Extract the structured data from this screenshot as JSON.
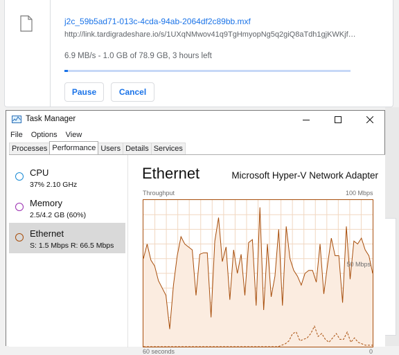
{
  "download": {
    "filename": "j2c_59b5ad71-013c-4cda-94ab-2064df2c89bb.mxf",
    "url": "http://link.tardigradeshare.io/s/1UXqNMwov41q9TgHmyopNg5q2giQ8aTdh1gjKWKjf…",
    "status": "6.9 MB/s - 1.0 GB of 78.9 GB, 3 hours left",
    "progress": 0.0127,
    "pause_label": "Pause",
    "cancel_label": "Cancel"
  },
  "task_manager": {
    "title": "Task Manager",
    "menu": [
      "File",
      "Options",
      "View"
    ],
    "tabs": [
      "Processes",
      "Performance",
      "Users",
      "Details",
      "Services"
    ],
    "active_tab": "Performance",
    "resources": [
      {
        "name": "CPU",
        "sub": "37%  2.10 GHz",
        "color": "#1a8ad4",
        "selected": false
      },
      {
        "name": "Memory",
        "sub": "2.5/4.2 GB (60%)",
        "color": "#9a2db1",
        "selected": false
      },
      {
        "name": "Ethernet",
        "sub": "S: 1.5 Mbps  R: 66.5 Mbps",
        "color": "#a74d0a",
        "selected": true
      }
    ],
    "detail": {
      "title": "Ethernet",
      "adapter": "Microsoft Hyper-V Network Adapter",
      "graph_label": "Throughput",
      "max_label": "100 Mbps",
      "mid_label": "50 Mbps",
      "time_label": "60 seconds",
      "min_label": "0"
    },
    "colors": {
      "line": "#a74d0a",
      "fill": "#fbece0",
      "grid": "#f1d7c1"
    },
    "receive_mbps": [
      60,
      70,
      59,
      55,
      45,
      40,
      35,
      12,
      42,
      62,
      75,
      70,
      68,
      66,
      35,
      63,
      64,
      64,
      20,
      72,
      88,
      58,
      68,
      32,
      66,
      50,
      63,
      35,
      71,
      73,
      28,
      95,
      25,
      70,
      34,
      48,
      80,
      28,
      82,
      60,
      52,
      48,
      42,
      50,
      52,
      52,
      44,
      70,
      36,
      56,
      74,
      62,
      62,
      30,
      82,
      46,
      72,
      70,
      74,
      66,
      62,
      50
    ],
    "send_mbps": [
      0,
      0,
      0,
      0,
      0,
      0,
      0,
      0,
      0,
      0,
      0,
      0,
      0,
      0,
      0,
      0,
      0,
      0,
      0,
      0,
      0,
      0,
      0,
      0,
      0,
      0,
      0,
      0,
      0,
      0,
      0,
      0,
      0,
      0,
      0,
      0,
      0,
      0,
      1,
      2,
      4,
      9,
      10,
      4,
      5,
      6,
      9,
      14,
      7,
      9,
      5,
      3,
      6,
      9,
      5,
      5,
      10,
      3,
      6,
      3,
      2,
      1,
      1,
      1
    ]
  }
}
